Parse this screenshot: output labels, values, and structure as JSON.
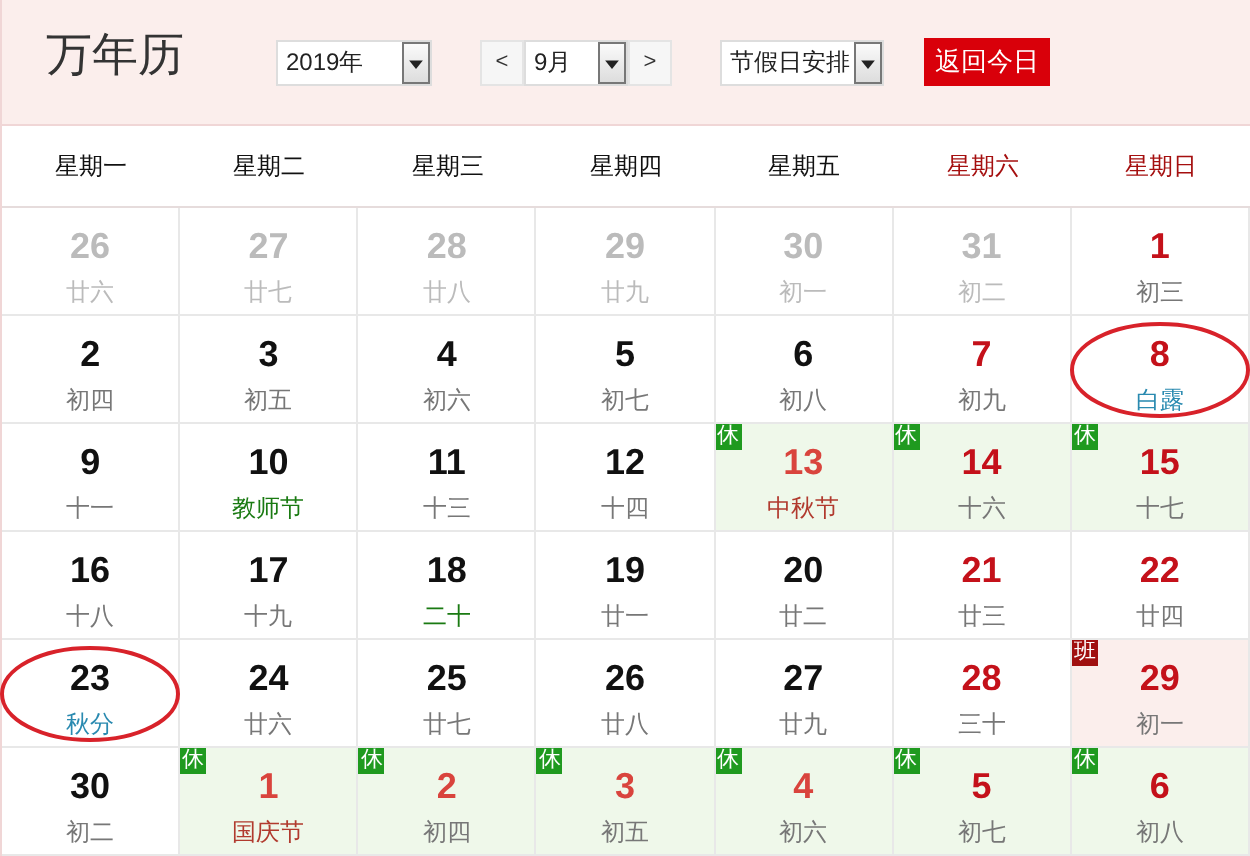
{
  "title": "万年历",
  "year_select": {
    "value": "2019年"
  },
  "month_nav": {
    "prev": "<",
    "value": "9月",
    "next": ">"
  },
  "holiday_select": {
    "value": "节假日安排"
  },
  "today_button": "返回今日",
  "weekdays": [
    {
      "label": "星期一",
      "weekend": false
    },
    {
      "label": "星期二",
      "weekend": false
    },
    {
      "label": "星期三",
      "weekend": false
    },
    {
      "label": "星期四",
      "weekend": false
    },
    {
      "label": "星期五",
      "weekend": false
    },
    {
      "label": "星期六",
      "weekend": true
    },
    {
      "label": "星期日",
      "weekend": true
    }
  ],
  "days": [
    {
      "day": "26",
      "kind": "other",
      "lunar": {
        "text": "廿六",
        "kind": "other"
      }
    },
    {
      "day": "27",
      "kind": "other",
      "lunar": {
        "text": "廿七",
        "kind": "other"
      }
    },
    {
      "day": "28",
      "kind": "other",
      "lunar": {
        "text": "廿八",
        "kind": "other"
      }
    },
    {
      "day": "29",
      "kind": "other",
      "lunar": {
        "text": "廿九",
        "kind": "other"
      }
    },
    {
      "day": "30",
      "kind": "other",
      "lunar": {
        "text": "初一",
        "kind": "other"
      }
    },
    {
      "day": "31",
      "kind": "other",
      "lunar": {
        "text": "初二",
        "kind": "other"
      }
    },
    {
      "day": "1",
      "kind": "weekend",
      "lunar": {
        "text": "初三",
        "kind": "plain"
      }
    },
    {
      "day": "2",
      "kind": "weekday",
      "lunar": {
        "text": "初四",
        "kind": "plain"
      }
    },
    {
      "day": "3",
      "kind": "weekday",
      "lunar": {
        "text": "初五",
        "kind": "plain"
      }
    },
    {
      "day": "4",
      "kind": "weekday",
      "lunar": {
        "text": "初六",
        "kind": "plain"
      }
    },
    {
      "day": "5",
      "kind": "weekday",
      "lunar": {
        "text": "初七",
        "kind": "plain"
      }
    },
    {
      "day": "6",
      "kind": "weekday",
      "lunar": {
        "text": "初八",
        "kind": "plain"
      }
    },
    {
      "day": "7",
      "kind": "weekend",
      "lunar": {
        "text": "初九",
        "kind": "plain"
      }
    },
    {
      "day": "8",
      "kind": "weekend",
      "lunar": {
        "text": "白露",
        "kind": "term"
      },
      "circled": true
    },
    {
      "day": "9",
      "kind": "weekday",
      "lunar": {
        "text": "十一",
        "kind": "plain"
      }
    },
    {
      "day": "10",
      "kind": "weekday",
      "lunar": {
        "text": "教师节",
        "kind": "festival"
      }
    },
    {
      "day": "11",
      "kind": "weekday",
      "lunar": {
        "text": "十三",
        "kind": "plain"
      }
    },
    {
      "day": "12",
      "kind": "weekday",
      "lunar": {
        "text": "十四",
        "kind": "plain"
      }
    },
    {
      "day": "13",
      "kind": "holiday",
      "lunar": {
        "text": "中秋节",
        "kind": "holiday"
      },
      "badge": "休"
    },
    {
      "day": "14",
      "kind": "weekend",
      "lunar": {
        "text": "十六",
        "kind": "plain"
      },
      "badge": "休",
      "rest": true
    },
    {
      "day": "15",
      "kind": "weekend",
      "lunar": {
        "text": "十七",
        "kind": "plain"
      },
      "badge": "休",
      "rest": true
    },
    {
      "day": "16",
      "kind": "weekday",
      "lunar": {
        "text": "十八",
        "kind": "plain"
      }
    },
    {
      "day": "17",
      "kind": "weekday",
      "lunar": {
        "text": "十九",
        "kind": "plain"
      }
    },
    {
      "day": "18",
      "kind": "weekday",
      "lunar": {
        "text": "二十",
        "kind": "festival"
      }
    },
    {
      "day": "19",
      "kind": "weekday",
      "lunar": {
        "text": "廿一",
        "kind": "plain"
      }
    },
    {
      "day": "20",
      "kind": "weekday",
      "lunar": {
        "text": "廿二",
        "kind": "plain"
      }
    },
    {
      "day": "21",
      "kind": "weekend",
      "lunar": {
        "text": "廿三",
        "kind": "plain"
      }
    },
    {
      "day": "22",
      "kind": "weekend",
      "lunar": {
        "text": "廿四",
        "kind": "plain"
      }
    },
    {
      "day": "23",
      "kind": "weekday",
      "lunar": {
        "text": "秋分",
        "kind": "term"
      },
      "circled": true
    },
    {
      "day": "24",
      "kind": "weekday",
      "lunar": {
        "text": "廿六",
        "kind": "plain"
      }
    },
    {
      "day": "25",
      "kind": "weekday",
      "lunar": {
        "text": "廿七",
        "kind": "plain"
      }
    },
    {
      "day": "26",
      "kind": "weekday",
      "lunar": {
        "text": "廿八",
        "kind": "plain"
      }
    },
    {
      "day": "27",
      "kind": "weekday",
      "lunar": {
        "text": "廿九",
        "kind": "plain"
      }
    },
    {
      "day": "28",
      "kind": "weekend",
      "lunar": {
        "text": "三十",
        "kind": "plain"
      }
    },
    {
      "day": "29",
      "kind": "workday",
      "lunar": {
        "text": "初一",
        "kind": "plain"
      },
      "badge": "班"
    },
    {
      "day": "30",
      "kind": "weekday",
      "lunar": {
        "text": "初二",
        "kind": "plain"
      }
    },
    {
      "day": "1",
      "kind": "holiday",
      "lunar": {
        "text": "国庆节",
        "kind": "holiday"
      },
      "badge": "休"
    },
    {
      "day": "2",
      "kind": "holiday",
      "lunar": {
        "text": "初四",
        "kind": "plain"
      },
      "badge": "休"
    },
    {
      "day": "3",
      "kind": "holiday",
      "lunar": {
        "text": "初五",
        "kind": "plain"
      },
      "badge": "休"
    },
    {
      "day": "4",
      "kind": "holiday",
      "lunar": {
        "text": "初六",
        "kind": "plain"
      },
      "badge": "休"
    },
    {
      "day": "5",
      "kind": "weekend",
      "lunar": {
        "text": "初七",
        "kind": "plain"
      },
      "badge": "休",
      "rest": true
    },
    {
      "day": "6",
      "kind": "weekend",
      "lunar": {
        "text": "初八",
        "kind": "plain"
      },
      "badge": "休",
      "rest": true
    }
  ]
}
